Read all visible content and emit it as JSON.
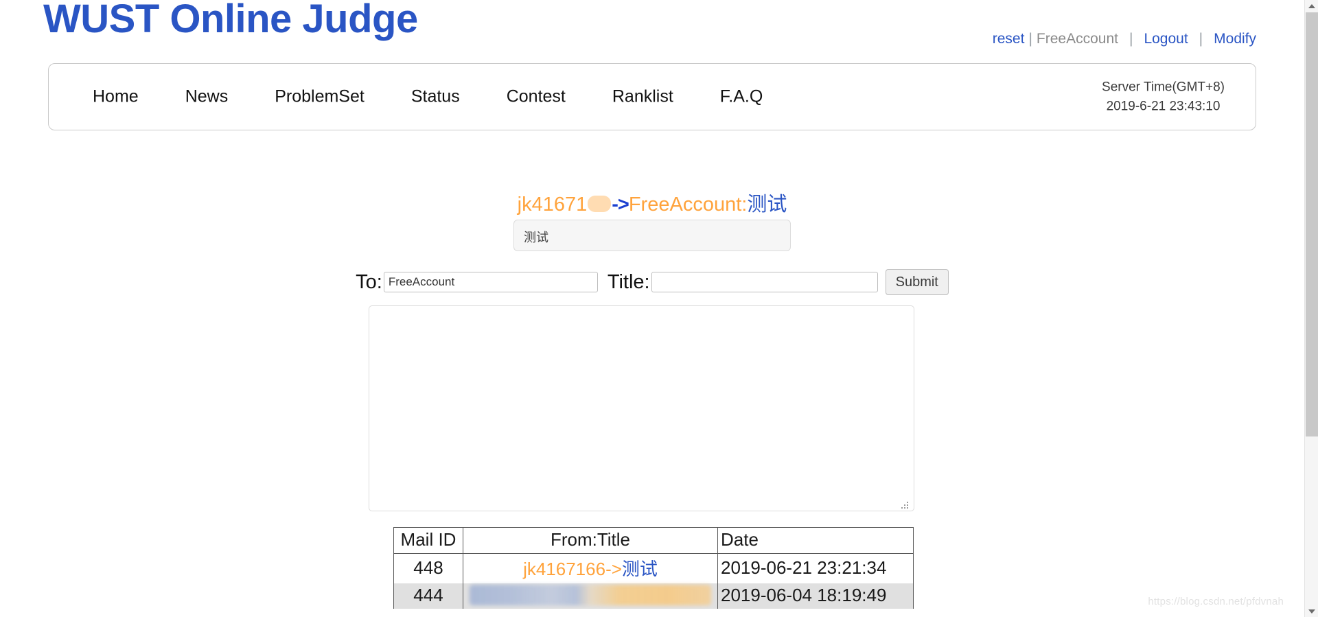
{
  "site": {
    "title": "WUST Online Judge"
  },
  "account_bar": {
    "reset_label": "reset",
    "separator": "|",
    "username": "FreeAccount",
    "logout_label": "Logout",
    "modify_label": "Modify"
  },
  "nav": {
    "items": [
      {
        "label": "Home"
      },
      {
        "label": "News"
      },
      {
        "label": "ProblemSet"
      },
      {
        "label": "Status"
      },
      {
        "label": "Contest"
      },
      {
        "label": "Ranklist"
      },
      {
        "label": "F.A.Q"
      }
    ],
    "server_time_label": "Server Time(GMT+8)",
    "server_time_value": "2019-6-21 23:43:10"
  },
  "conversation": {
    "from_user": "jk41671",
    "arrow": "->",
    "to_user": "FreeAccount",
    "colon": ":",
    "subject": "测试",
    "body": "测试"
  },
  "compose": {
    "to_label": "To:",
    "to_value": "FreeAccount",
    "to_placeholder": "",
    "title_label": "Title:",
    "title_value": "",
    "title_placeholder": "",
    "submit_label": "Submit",
    "message_value": "",
    "message_placeholder": ""
  },
  "mail_table": {
    "columns": [
      "Mail ID",
      "From:Title",
      "Date"
    ],
    "rows": [
      {
        "mail_id": "448",
        "from": "jk4167166",
        "arrow": "->",
        "subject": "测试",
        "date": "2019-06-21 23:21:34",
        "redacted": false
      },
      {
        "mail_id": "444",
        "from": "",
        "arrow": "",
        "subject": "",
        "date": "2019-06-04 18:19:49",
        "redacted": true
      }
    ]
  },
  "watermark": {
    "text": "https://blog.csdn.net/pfdvnah"
  },
  "colors": {
    "brand_blue": "#2a55c4",
    "link_blue": "#2a55c4",
    "mail_orange": "#ffa33c",
    "arrow_blue": "#1a3fd0",
    "muted_gray": "#8a8a8a",
    "row_alt_bg": "#e0e0e0"
  }
}
